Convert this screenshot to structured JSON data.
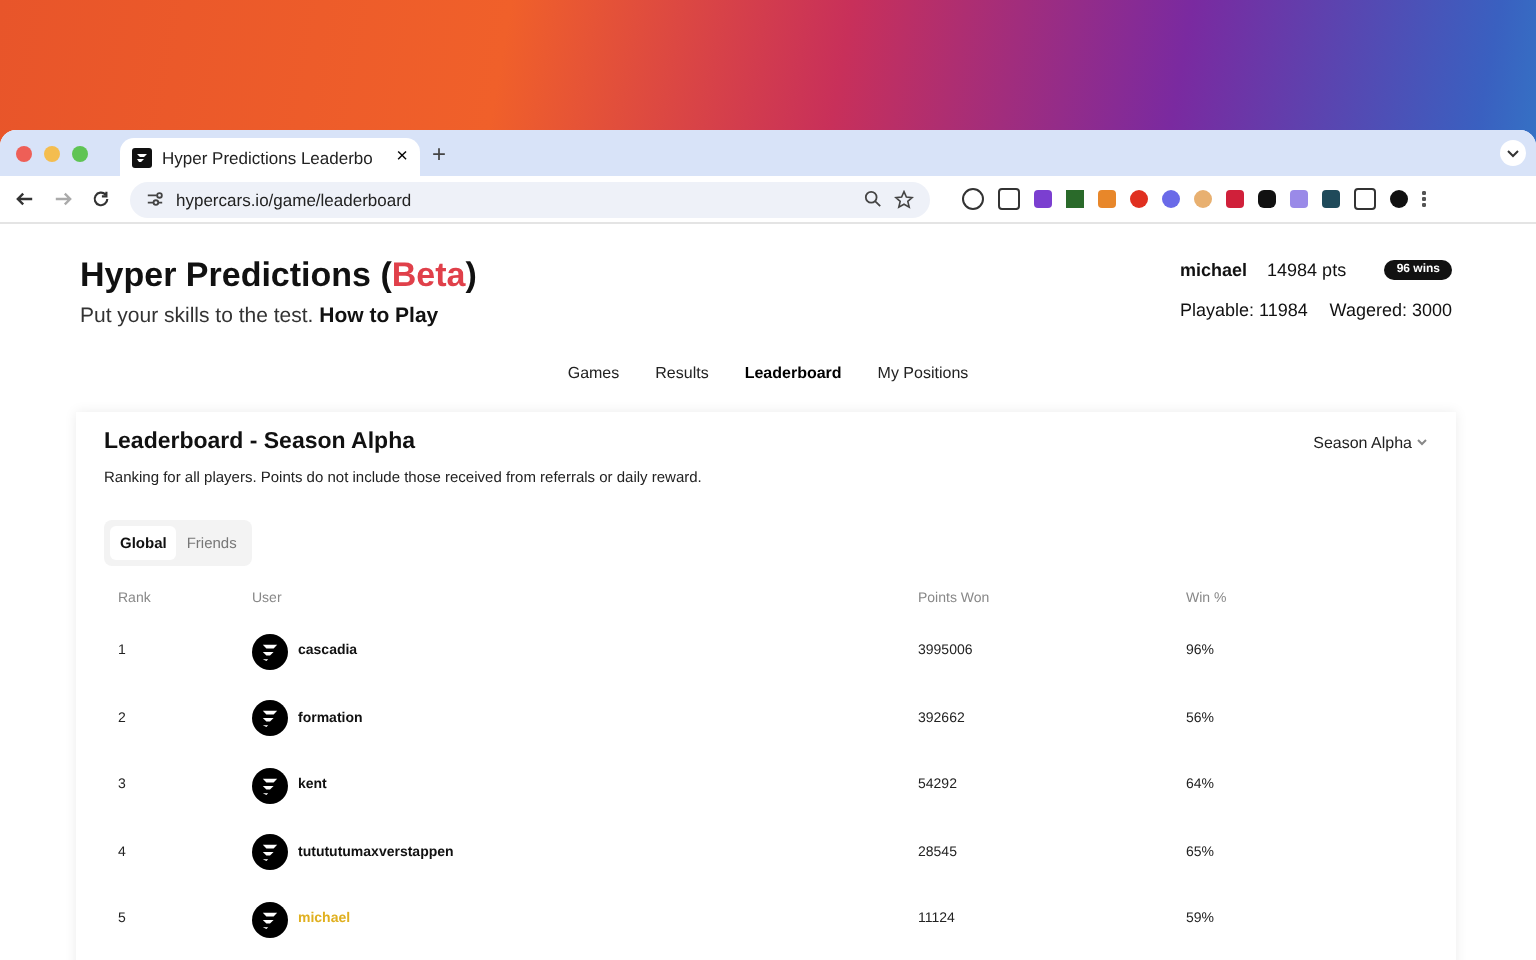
{
  "browser": {
    "tab_title": "Hyper Predictions Leaderbo",
    "tab_close": "×",
    "new_tab": "+",
    "url": "hypercars.io/game/leaderboard"
  },
  "header": {
    "title": "Hyper Predictions (",
    "title_accent": "Beta",
    "title_end": ")",
    "subtitle": "Put your skills to the test.",
    "help_link": "How to Play",
    "username": "michael",
    "points": "14984 pts",
    "wins_badge": "96 wins",
    "playable": "Playable: 11984",
    "wagered": "Wagered: 3000"
  },
  "nav": [
    {
      "label": "Games",
      "selected": false
    },
    {
      "label": "Results",
      "selected": false
    },
    {
      "label": "Leaderboard",
      "selected": true
    },
    {
      "label": "My Positions",
      "selected": false
    }
  ],
  "leaderboard": {
    "title": "Leaderboard - Season Alpha",
    "season_dropdown": "Season Alpha",
    "description": "Ranking for all players. Points do not include those received from referrals or daily reward.",
    "tabs": [
      {
        "label": "Global",
        "selected": true
      },
      {
        "label": "Friends",
        "selected": false
      }
    ],
    "columns": [
      "Rank",
      "User",
      "Points Won",
      "Win %"
    ],
    "rows": [
      {
        "rank": "1",
        "user": "cascadia",
        "points": "3995006",
        "win": "96%",
        "current_user": false
      },
      {
        "rank": "2",
        "user": "formation",
        "points": "392662",
        "win": "56%",
        "current_user": false
      },
      {
        "rank": "3",
        "user": "kent",
        "points": "54292",
        "win": "64%",
        "current_user": false
      },
      {
        "rank": "4",
        "user": "tutututumaxverstappen",
        "points": "28545",
        "win": "65%",
        "current_user": false
      },
      {
        "rank": "5",
        "user": "michael",
        "points": "11124",
        "win": "59%",
        "current_user": true
      }
    ]
  }
}
